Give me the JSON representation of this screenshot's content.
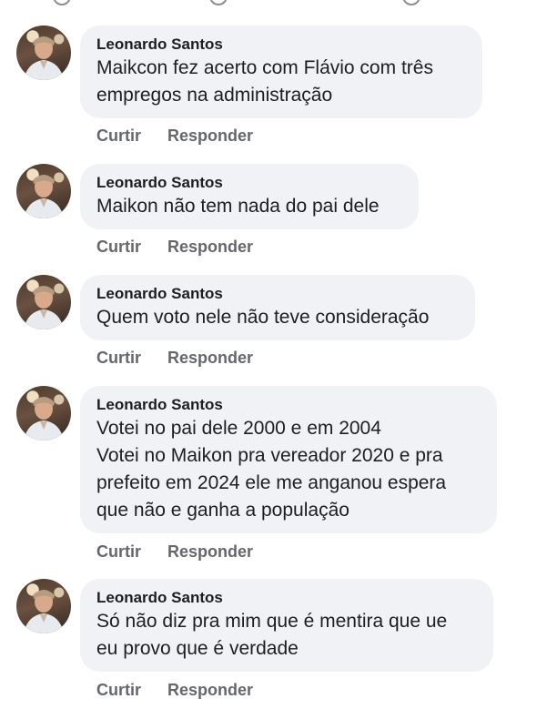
{
  "comments": [
    {
      "author": "Leonardo Santos",
      "lines": [
        "Maikcon fez acerto com Flávio com três",
        "empregos na administração"
      ],
      "like_label": "Curtir",
      "reply_label": "Responder"
    },
    {
      "author": "Leonardo Santos",
      "lines": [
        "Maikon não tem nada do pai dele"
      ],
      "like_label": "Curtir",
      "reply_label": "Responder"
    },
    {
      "author": "Leonardo Santos",
      "lines": [
        "Quem voto nele não teve consideração"
      ],
      "like_label": "Curtir",
      "reply_label": "Responder"
    },
    {
      "author": "Leonardo Santos",
      "lines": [
        "Votei no pai dele 2000 e em 2004",
        "Votei no Maikon pra vereador 2020 e pra",
        "prefeito em 2024 ele me anganou espera",
        "que não e ganha a população"
      ],
      "like_label": "Curtir",
      "reply_label": "Responder"
    },
    {
      "author": "Leonardo Santos",
      "lines": [
        "Só não diz pra mim que é mentira que ue",
        "eu provo que é verdade"
      ],
      "like_label": "Curtir",
      "reply_label": "Responder"
    }
  ],
  "colors": {
    "bubble": "#f0f2f5",
    "text": "#1c1e21",
    "muted": "#65676b"
  }
}
